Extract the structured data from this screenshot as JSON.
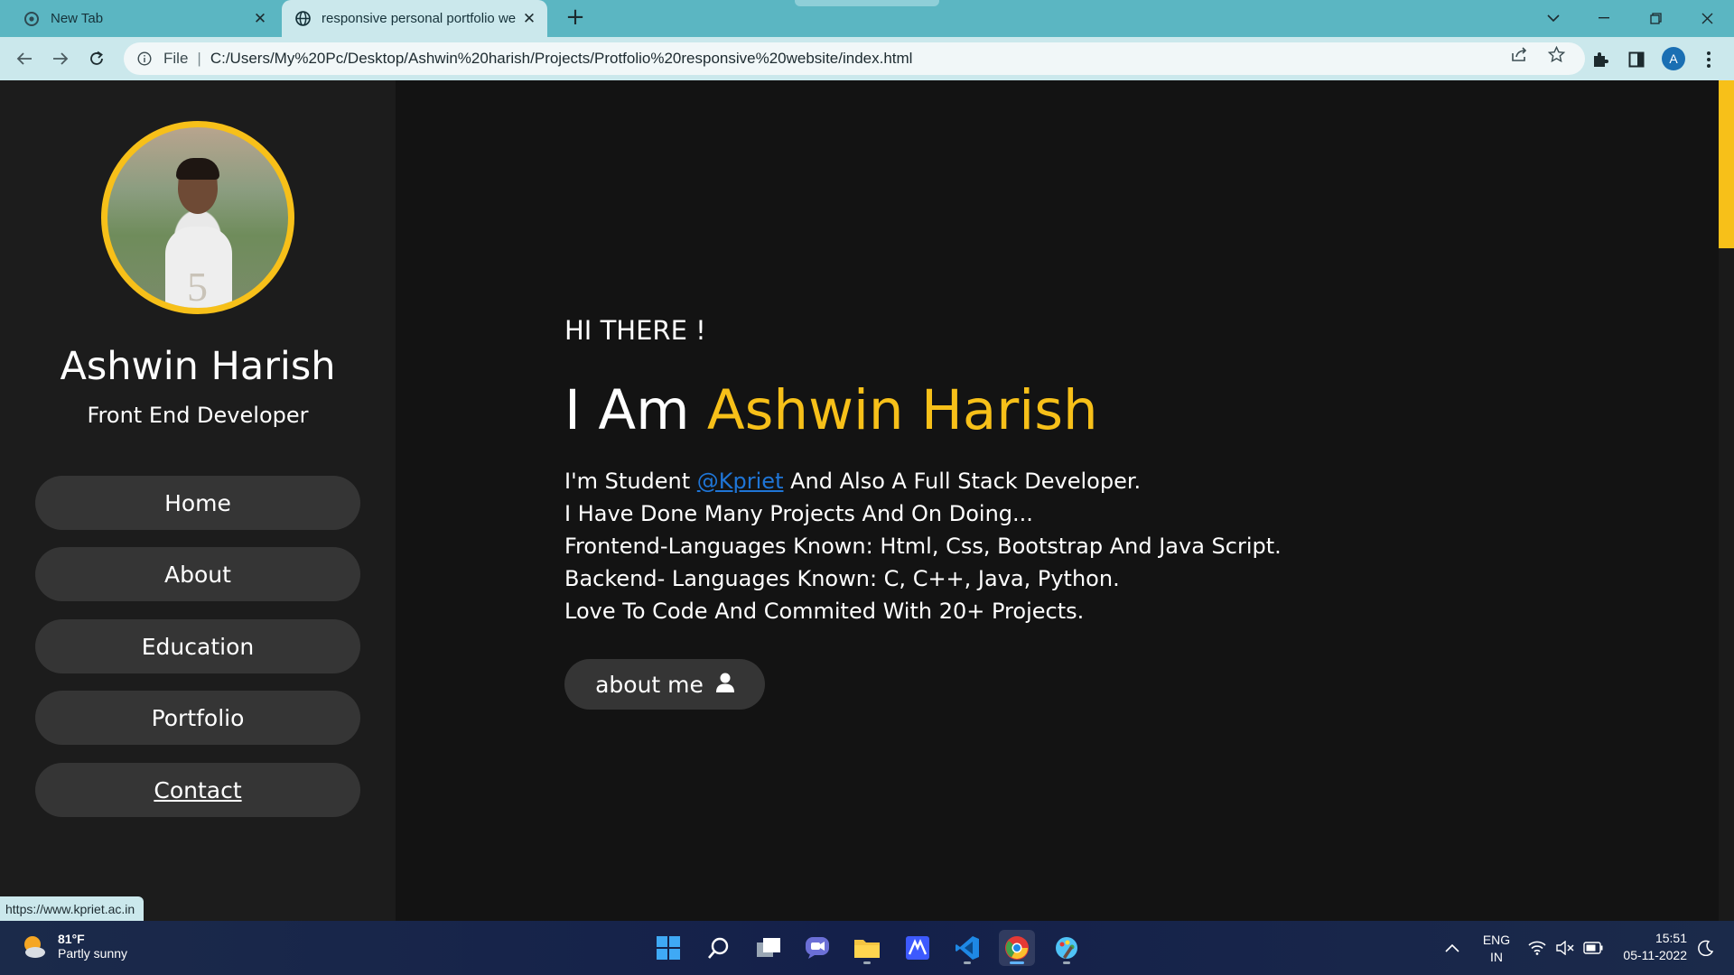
{
  "browser": {
    "tabs": [
      {
        "title": "New Tab"
      },
      {
        "title": "responsive personal portfolio we"
      }
    ],
    "omnibox": {
      "scheme_label": "File",
      "url": "C:/Users/My%20Pc/Desktop/Ashwin%20harish/Projects/Protfolio%20responsive%20website/index.html"
    },
    "profile_initial": "A",
    "status_url": "https://www.kpriet.ac.in"
  },
  "page": {
    "sidebar": {
      "name": "Ashwin Harish",
      "role": "Front End Developer",
      "nav": [
        {
          "label": "Home"
        },
        {
          "label": "About"
        },
        {
          "label": "Education"
        },
        {
          "label": "Portfolio"
        },
        {
          "label": "Contact"
        }
      ],
      "avatar_number": "5"
    },
    "hero": {
      "greeting": "HI THERE !",
      "headline_prefix": "I Am ",
      "headline_name": "Ashwin Harish",
      "line1_prefix": "I'm Student ",
      "line1_link": "@Kpriet",
      "line1_suffix": " And Also A Full Stack Developer.",
      "line2": "I Have Done Many Projects And On Doing...",
      "line3": "Frontend-Languages Known: Html, Css, Bootstrap And Java Script.",
      "line4": "Backend- Languages Known: C, C++, Java, Python.",
      "line5": "Love To Code And Commited With 20+ Projects.",
      "button_label": "about me"
    },
    "colors": {
      "accent": "#f7c019",
      "link": "#1f75d6",
      "panel": "#1c1c1c",
      "button": "#353535"
    }
  },
  "taskbar": {
    "weather_temp": "81°F",
    "weather_condition": "Partly sunny",
    "lang_line1": "ENG",
    "lang_line2": "IN",
    "time": "15:51",
    "date": "05-11-2022",
    "apps": [
      "start-icon",
      "search-icon",
      "task-view-icon",
      "teams-chat-icon",
      "file-explorer-icon",
      "app-icon",
      "vscode-icon",
      "chrome-icon",
      "paint-icon"
    ]
  }
}
